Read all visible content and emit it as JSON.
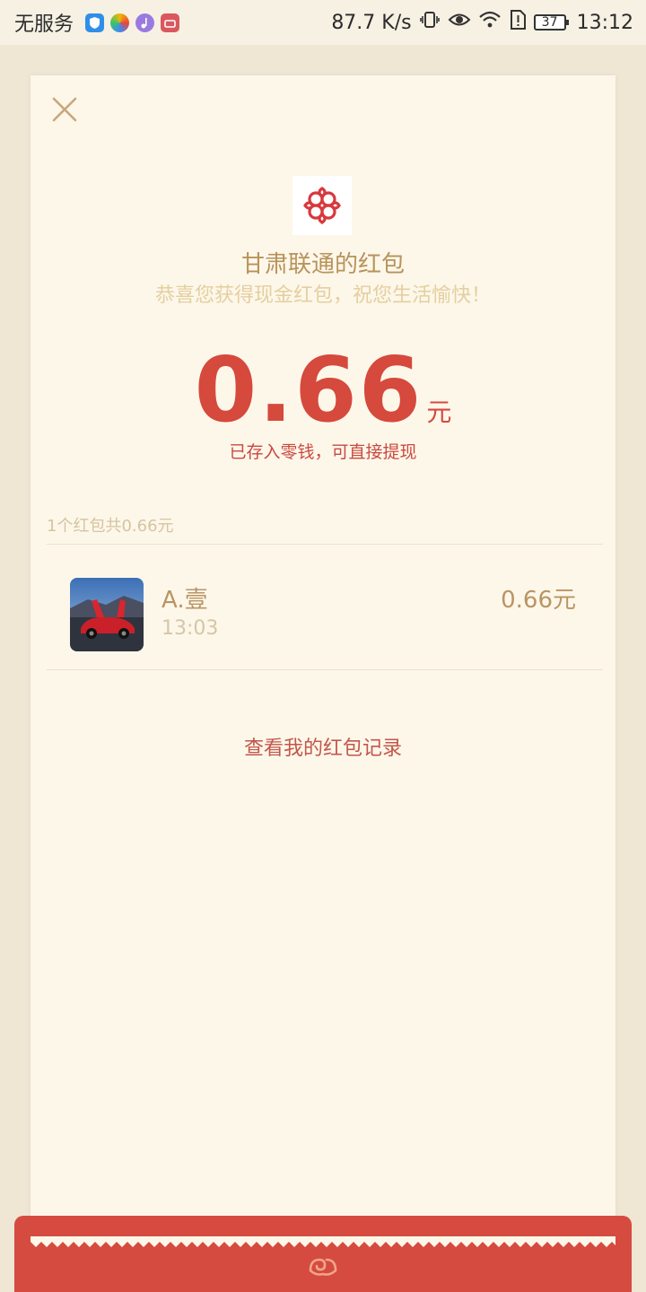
{
  "status_bar": {
    "carrier": "无服务",
    "speed": "87.7 K/s",
    "battery": "37",
    "time": "13:12",
    "icons": [
      "shield-app-icon",
      "colorful-app-icon",
      "music-app-icon",
      "red-app-icon",
      "vibrate-icon",
      "eye-icon",
      "wifi-icon",
      "sim-alert-icon",
      "battery-icon"
    ]
  },
  "card": {
    "title": "甘肃联通的红包",
    "subtitle": "恭喜您获得现金红包，祝您生活愉快！",
    "amount": "0.66",
    "amount_unit": "元",
    "stored_note": "已存入零钱，可直接提现",
    "summary": "1个红包共0.66元",
    "records": [
      {
        "name": "A.壹",
        "time": "13:03",
        "amount": "0.66元"
      }
    ],
    "view_records_link": "查看我的红包记录"
  },
  "colors": {
    "accent_red": "#d6493d",
    "gold_text": "#b8935a",
    "card_bg": "#fdf7ea",
    "page_bg": "#efe6d4"
  }
}
